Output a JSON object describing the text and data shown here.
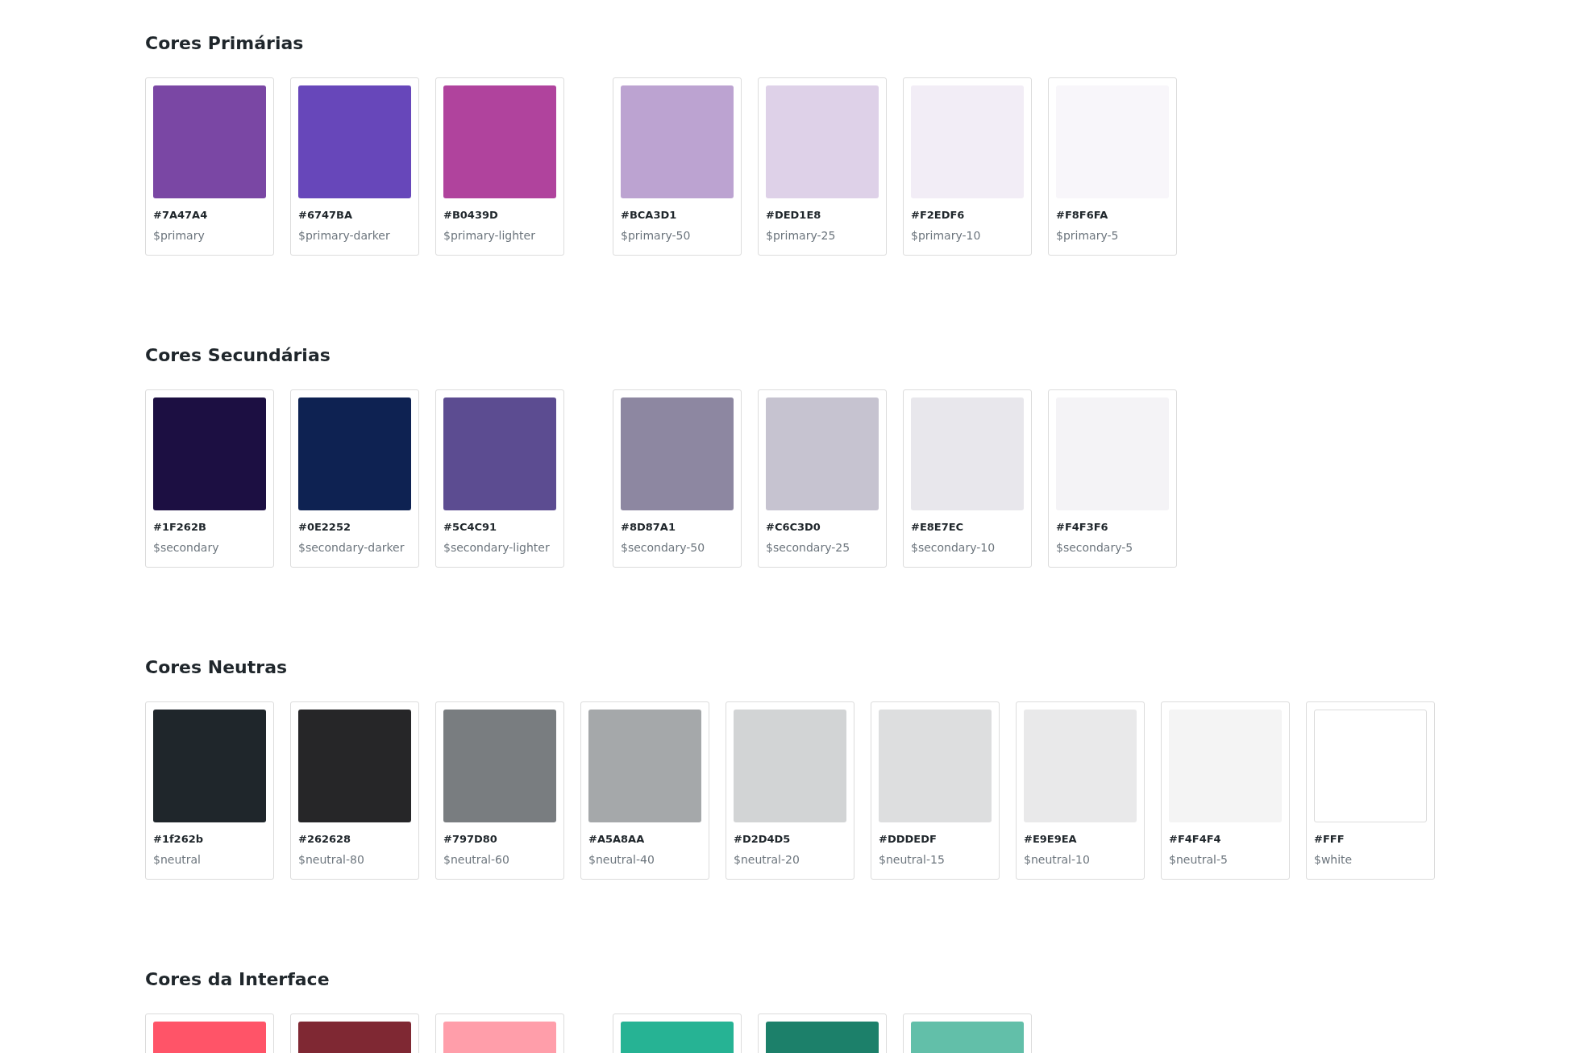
{
  "sections": [
    {
      "title": "Cores Primárias",
      "groups": [
        [
          {
            "hex": "#7A47A4",
            "name": "$primary",
            "color": "#7a47a4"
          },
          {
            "hex": "#6747BA",
            "name": "$primary-darker",
            "color": "#6747ba"
          },
          {
            "hex": "#B0439D",
            "name": "$primary-lighter",
            "color": "#b0439d"
          }
        ],
        [
          {
            "hex": "#BCA3D1",
            "name": "$primary-50",
            "color": "#bca3d1"
          },
          {
            "hex": "#DED1E8",
            "name": "$primary-25",
            "color": "#ded1e8"
          },
          {
            "hex": "#F2EDF6",
            "name": "$primary-10",
            "color": "#f2edf6"
          },
          {
            "hex": "#F8F6FA",
            "name": "$primary-5",
            "color": "#f8f6fa"
          }
        ]
      ]
    },
    {
      "title": "Cores Secundárias",
      "groups": [
        [
          {
            "hex": "#1F262B",
            "name": "$secondary",
            "color": "#1c0f42"
          },
          {
            "hex": "#0E2252",
            "name": "$secondary-darker",
            "color": "#0e2252"
          },
          {
            "hex": "#5C4C91",
            "name": "$secondary-lighter",
            "color": "#5c4c91"
          }
        ],
        [
          {
            "hex": "#8D87A1",
            "name": "$secondary-50",
            "color": "#8d87a1"
          },
          {
            "hex": "#C6C3D0",
            "name": "$secondary-25",
            "color": "#c6c3d0"
          },
          {
            "hex": "#E8E7EC",
            "name": "$secondary-10",
            "color": "#e8e7ec"
          },
          {
            "hex": "#F4F3F6",
            "name": "$secondary-5",
            "color": "#f4f3f6"
          }
        ]
      ]
    },
    {
      "title": "Cores Neutras",
      "groups": [
        [
          {
            "hex": "#1f262b",
            "name": "$neutral",
            "color": "#1f262b"
          },
          {
            "hex": "#262628",
            "name": "$neutral-80",
            "color": "#262628"
          },
          {
            "hex": "#797D80",
            "name": "$neutral-60",
            "color": "#797d80"
          },
          {
            "hex": "#A5A8AA",
            "name": "$neutral-40",
            "color": "#a5a8aa"
          },
          {
            "hex": "#D2D4D5",
            "name": "$neutral-20",
            "color": "#d2d4d5"
          },
          {
            "hex": "#DDDEDF",
            "name": "$neutral-15",
            "color": "#dddedf"
          },
          {
            "hex": "#E9E9EA",
            "name": "$neutral-10",
            "color": "#e9e9ea"
          },
          {
            "hex": "#F4F4F4",
            "name": "$neutral-5",
            "color": "#f4f4f4"
          },
          {
            "hex": "#FFF",
            "name": "$white",
            "color": "#ffffff"
          }
        ]
      ]
    },
    {
      "title": "Cores da Interface",
      "groups": [
        [
          {
            "color": "#ff5468"
          },
          {
            "color": "#7f2833"
          },
          {
            "color": "#ff9eaa"
          }
        ],
        [
          {
            "color": "#26b394"
          },
          {
            "color": "#1c806a"
          },
          {
            "color": "#62bfa9"
          }
        ]
      ]
    }
  ]
}
